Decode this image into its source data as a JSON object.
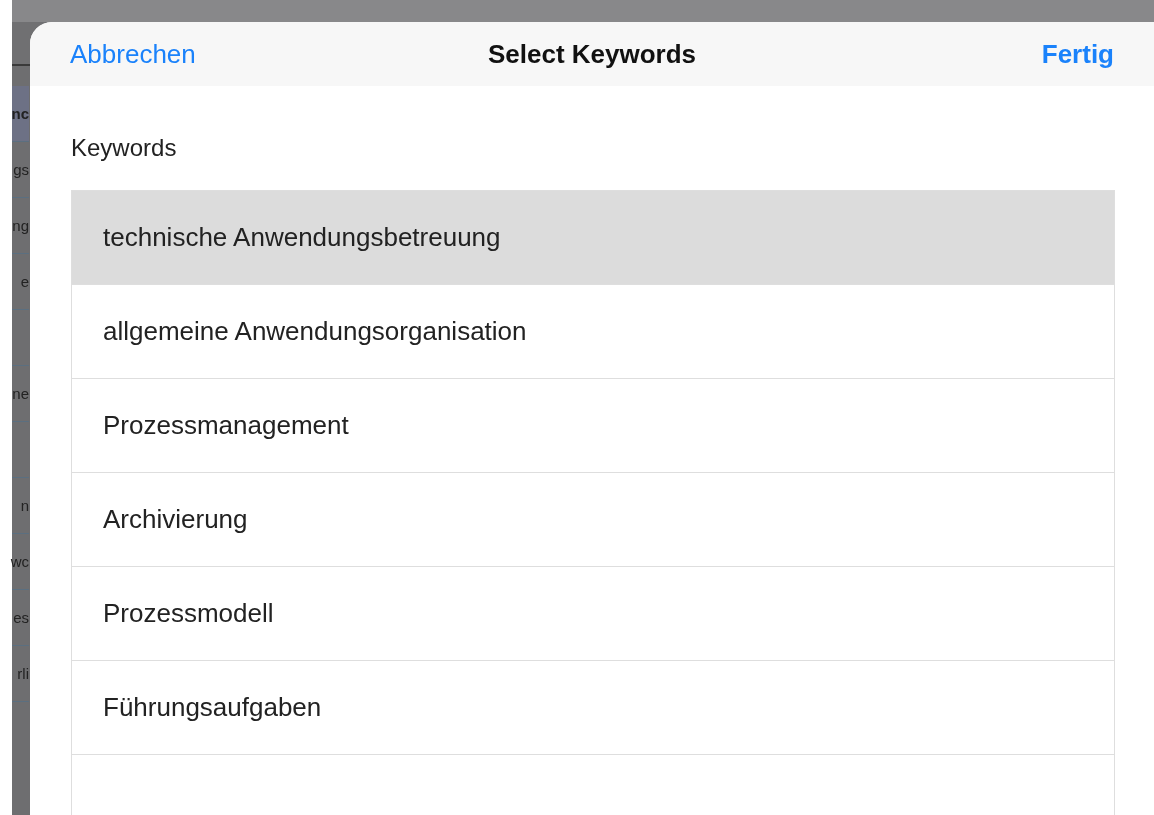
{
  "background_rows": [
    {
      "text": "nc",
      "selected": true
    },
    {
      "text": "gs",
      "selected": false
    },
    {
      "text": "ng",
      "selected": false
    },
    {
      "text": "e",
      "selected": false
    },
    {
      "selected": false
    },
    {
      "text": "ne",
      "selected": false
    },
    {
      "selected": false
    },
    {
      "text": "n",
      "selected": false
    },
    {
      "text": "wc",
      "selected": false
    },
    {
      "text": "es",
      "selected": false
    },
    {
      "text": "rli",
      "selected": false
    }
  ],
  "sheet": {
    "cancel": "Abbrechen",
    "title": "Select Keywords",
    "done": "Fertig",
    "section_label": "Keywords",
    "items": [
      {
        "label": "technische Anwendungsbetreuung",
        "selected": true
      },
      {
        "label": "allgemeine Anwendungsorganisation",
        "selected": false
      },
      {
        "label": "Prozessmanagement",
        "selected": false
      },
      {
        "label": "Archivierung",
        "selected": false
      },
      {
        "label": "Prozessmodell",
        "selected": false
      },
      {
        "label": "Führungsaufgaben",
        "selected": false
      }
    ]
  }
}
